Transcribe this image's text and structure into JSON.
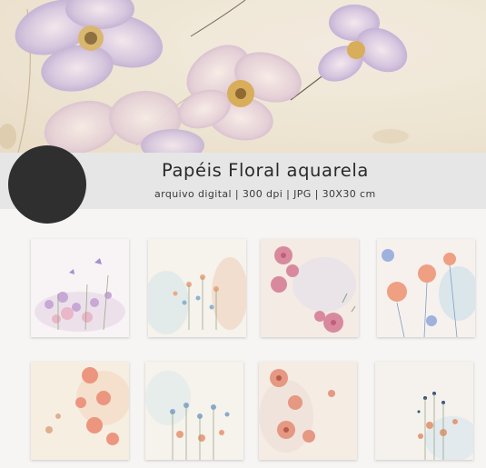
{
  "product": {
    "title": "Papéis Floral aquarela",
    "subtitle": "arquivo digital | 300 dpi | JPG | 30X30 cm"
  },
  "colors": {
    "strip": "#e6e6e6",
    "dot": "#2f2f2f",
    "background": "#f7f5f3"
  },
  "thumbnails": [
    {
      "label": "lavender-wildflowers"
    },
    {
      "label": "pastel-meadow"
    },
    {
      "label": "pink-blossoms"
    },
    {
      "label": "coral-poppies"
    },
    {
      "label": "peach-blossoms"
    },
    {
      "label": "blue-meadow"
    },
    {
      "label": "salmon-blossoms"
    },
    {
      "label": "dotted-meadow"
    }
  ]
}
